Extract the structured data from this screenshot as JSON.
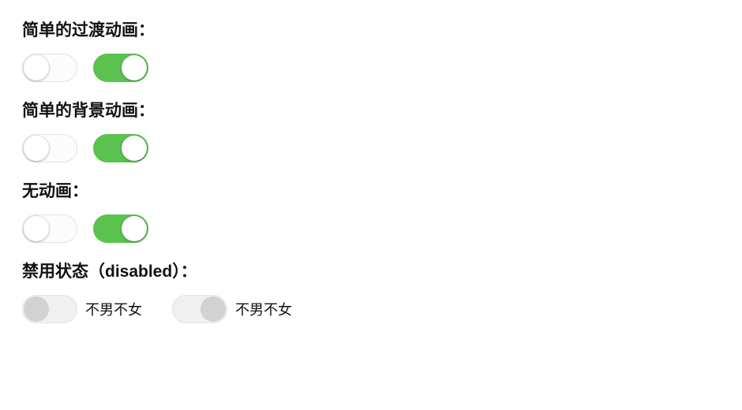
{
  "sections": {
    "transition": {
      "label": "简单的过渡动画：",
      "switch_off": {
        "on": false
      },
      "switch_on": {
        "on": true
      }
    },
    "background": {
      "label": "简单的背景动画：",
      "switch_off": {
        "on": false
      },
      "switch_on": {
        "on": true
      }
    },
    "noanim": {
      "label": "无动画：",
      "switch_off": {
        "on": false
      },
      "switch_on": {
        "on": true
      }
    },
    "disabled": {
      "label": "禁用状态（disabled）：",
      "item1": {
        "text": "不男不女"
      },
      "item2": {
        "text": "不男不女"
      }
    }
  },
  "colors": {
    "accent": "#5bc24f"
  }
}
